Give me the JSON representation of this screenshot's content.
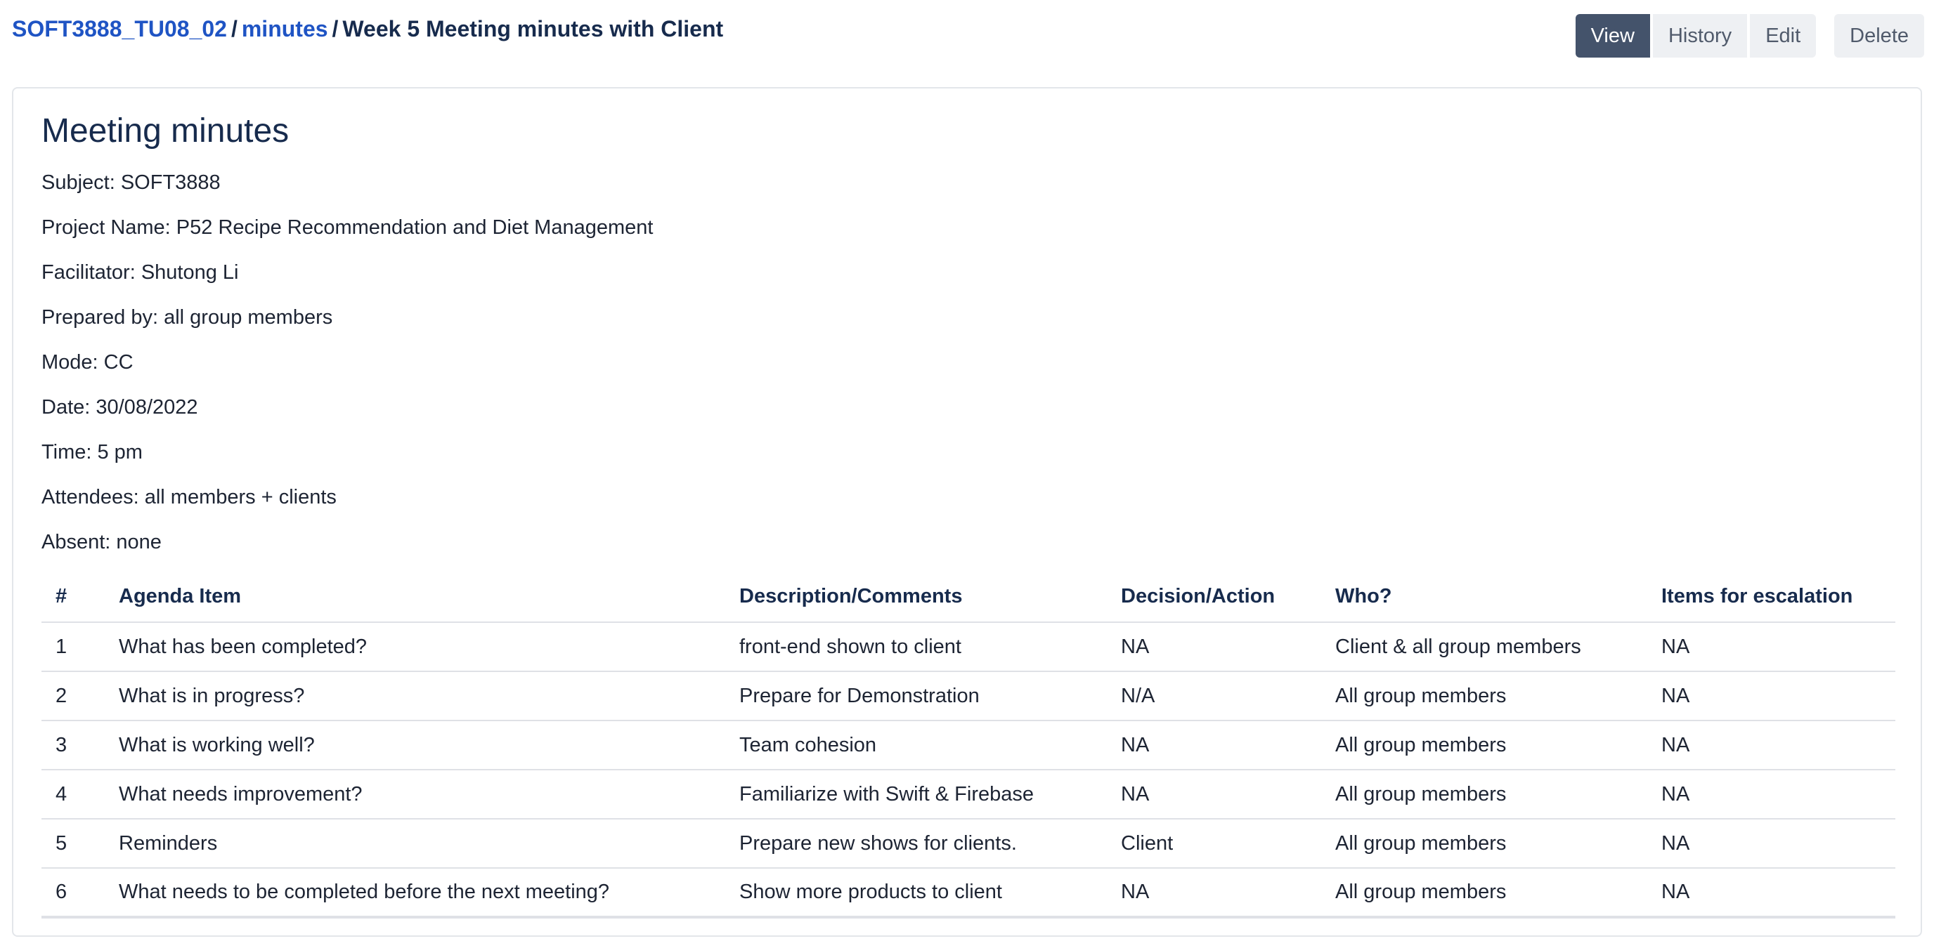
{
  "breadcrumb": {
    "space": "SOFT3888_TU08_02",
    "parent": "minutes",
    "current": "Week 5 Meeting minutes with Client",
    "separator": "/"
  },
  "toolbar": {
    "view_label": "View",
    "history_label": "History",
    "edit_label": "Edit",
    "delete_label": "Delete"
  },
  "colors": {
    "link": "#1f54c4",
    "active_button": "#44536b"
  },
  "page": {
    "title": "Meeting minutes",
    "meta": [
      "Subject: SOFT3888",
      "Project Name: P52 Recipe Recommendation and Diet Management",
      "Facilitator: Shutong Li",
      "Prepared by: all group members",
      "Mode: CC",
      "Date: 30/08/2022",
      "Time: 5 pm",
      "Attendees: all members + clients",
      "Absent: none"
    ]
  },
  "table": {
    "headers": [
      "#",
      "Agenda Item",
      "Description/Comments",
      "Decision/Action",
      "Who?",
      "Items for escalation"
    ],
    "rows": [
      [
        "1",
        "What has been completed?",
        "front-end shown to client",
        "NA",
        "Client & all group members",
        "NA"
      ],
      [
        "2",
        "What is in progress?",
        "Prepare for Demonstration",
        "N/A",
        "All group members",
        "NA"
      ],
      [
        "3",
        "What is working well?",
        "Team cohesion",
        "NA",
        "All group members",
        "NA"
      ],
      [
        "4",
        "What needs improvement?",
        "Familiarize with Swift & Firebase",
        "NA",
        "All group members",
        "NA"
      ],
      [
        "5",
        "Reminders",
        "Prepare new shows for clients.",
        "Client",
        "All group members",
        "NA"
      ],
      [
        "6",
        "What needs to be completed before the next meeting?",
        "Show more products to client",
        "NA",
        "All group members",
        "NA"
      ]
    ]
  }
}
